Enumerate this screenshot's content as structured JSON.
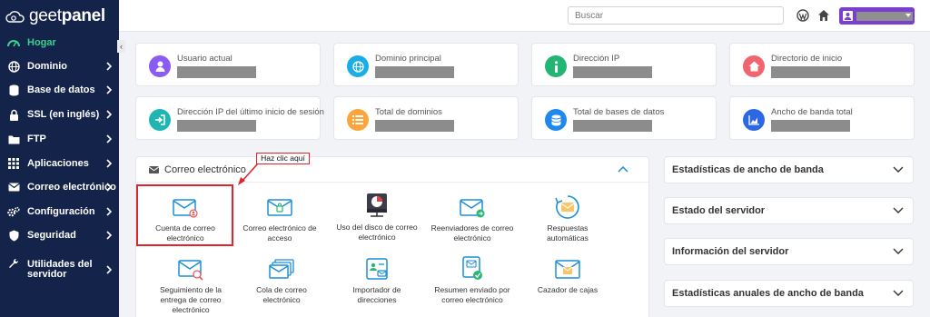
{
  "brand": {
    "logo_text_light": "geet",
    "logo_text_bold": "panel"
  },
  "sidebar": {
    "items": [
      {
        "label": "Hogar",
        "icon": "dashboard-icon",
        "active": true,
        "has_chevron": false
      },
      {
        "label": "Dominio",
        "icon": "globe-icon",
        "has_chevron": true
      },
      {
        "label": "Base de datos",
        "icon": "database-icon",
        "has_chevron": true
      },
      {
        "label": "SSL (en inglés)",
        "icon": "lock-icon",
        "has_chevron": true
      },
      {
        "label": "FTP",
        "icon": "folder-icon",
        "has_chevron": true
      },
      {
        "label": "Aplicaciones",
        "icon": "grid-icon",
        "has_chevron": true
      },
      {
        "label": "Correo electrónico",
        "icon": "envelope-icon",
        "has_chevron": true
      },
      {
        "label": "Configuración",
        "icon": "cogs-icon",
        "has_chevron": true
      },
      {
        "label": "Seguridad",
        "icon": "shield-icon",
        "has_chevron": true
      },
      {
        "label": "Utilidades del servidor",
        "icon": "wrench-icon",
        "has_chevron": true
      }
    ],
    "collapse_glyph": "‹"
  },
  "topbar": {
    "search_placeholder": "Buscar"
  },
  "cards": [
    {
      "label": "Usuario actual",
      "icon": "user-icon",
      "color": "#8a5cf5"
    },
    {
      "label": "Dominio principal",
      "icon": "globe-icon",
      "color": "#1aaee6"
    },
    {
      "label": "Dirección IP",
      "icon": "info-icon",
      "color": "#22b573"
    },
    {
      "label": "Directorio de inicio",
      "icon": "home-icon",
      "color": "#f0656e"
    },
    {
      "label": "Dirección IP del último inicio de sesión",
      "icon": "sign-in-icon",
      "color": "#1fb5b0"
    },
    {
      "label": "Total de dominios",
      "icon": "list-icon",
      "color": "#fba53c"
    },
    {
      "label": "Total de bases de datos",
      "icon": "database-icon",
      "color": "#1e87f0"
    },
    {
      "label": "Ancho de banda total",
      "icon": "chart-icon",
      "color": "#2c68e3"
    }
  ],
  "email_panel": {
    "title": "Correo electrónico",
    "tools": [
      {
        "label": "Cuenta de correo electrónico",
        "icon": "email-account-icon"
      },
      {
        "label": "Correo electrónico de acceso",
        "icon": "email-access-icon"
      },
      {
        "label": "Uso del disco de correo electrónico",
        "icon": "disk-usage-icon"
      },
      {
        "label": "Reenviadores de correo electrónico",
        "icon": "email-forward-icon"
      },
      {
        "label": "Respuestas automáticas",
        "icon": "autoresponder-icon"
      },
      {
        "label": "Seguimiento de la entrega de correo electrónico",
        "icon": "delivery-tracking-icon"
      },
      {
        "label": "Cola de correo electrónico",
        "icon": "mail-queue-icon"
      },
      {
        "label": "Importador de direcciones",
        "icon": "address-importer-icon"
      },
      {
        "label": "Resumen enviado por correo electrónico",
        "icon": "email-summary-icon"
      },
      {
        "label": "Cazador de cajas",
        "icon": "box-catcher-icon"
      }
    ]
  },
  "annotation": {
    "callout": "Haz clic aquí"
  },
  "right_panels": [
    {
      "title": "Estadísticas de ancho de banda"
    },
    {
      "title": "Estado del servidor"
    },
    {
      "title": "Información del servidor"
    },
    {
      "title": "Estadísticas anuales de ancho de banda"
    }
  ],
  "colors": {
    "sidebar_bg": "#14234a",
    "active": "#3ccf8e",
    "accent_icon": "#1a8fd8",
    "highlight": "#e0242b",
    "user_button": "#7b3fcf"
  }
}
